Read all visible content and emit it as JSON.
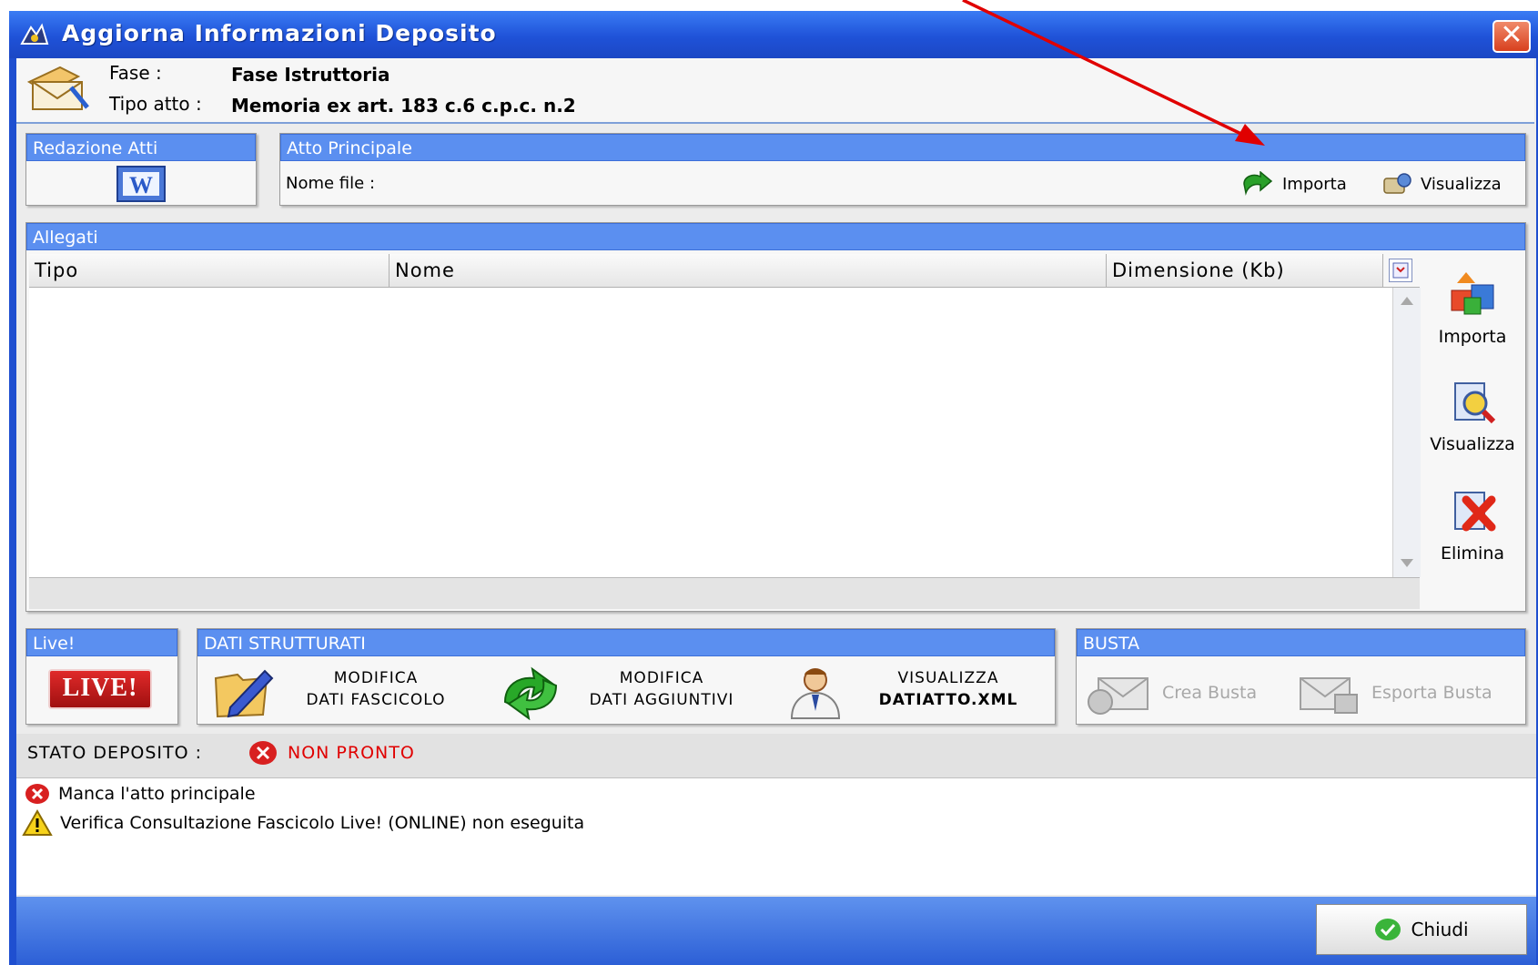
{
  "window": {
    "title": "Aggiorna Informazioni Deposito",
    "close_icon": "close-icon"
  },
  "header": {
    "fase_label": "Fase :",
    "fase_value": "Fase Istruttoria",
    "tipo_label": "Tipo atto :",
    "tipo_value": "Memoria ex art. 183 c.6 c.p.c. n.2"
  },
  "redazione": {
    "title": "Redazione Atti",
    "icon": "word-icon"
  },
  "atto_principale": {
    "title": "Atto Principale",
    "nome_file_label": "Nome file :",
    "importa_label": "Importa",
    "visualizza_label": "Visualizza"
  },
  "allegati": {
    "title": "Allegati",
    "columns": [
      "Tipo",
      "Nome",
      "Dimensione (Kb)"
    ],
    "rows": [],
    "actions": {
      "importa": "Importa",
      "visualizza": "Visualizza",
      "elimina": "Elimina"
    }
  },
  "live": {
    "title": "Live!",
    "logo_text": "LIVE!"
  },
  "dati_strutturati": {
    "title": "DATI STRUTTURATI",
    "modifica_fascicolo": {
      "line1": "MODIFICA",
      "line2": "DATI FASCICOLO"
    },
    "modifica_aggiuntivi": {
      "line1": "MODIFICA",
      "line2": "DATI AGGIUNTIVI"
    },
    "visualizza_xml": {
      "line1": "VISUALIZZA",
      "line2": "DATIATTO.XML"
    }
  },
  "busta": {
    "title": "BUSTA",
    "crea": "Crea Busta",
    "esporta": "Esporta Busta"
  },
  "stato": {
    "label": "STATO DEPOSITO :",
    "value": "NON PRONTO",
    "color": "#e00000",
    "messages": [
      {
        "icon": "error-icon",
        "text": "Manca l'atto principale"
      },
      {
        "icon": "warning-icon",
        "text": "Verifica Consultazione Fascicolo Live! (ONLINE) non eseguita"
      }
    ]
  },
  "footer": {
    "chiudi": "Chiudi"
  },
  "colors": {
    "titlebar": "#1f52d8",
    "panel_header": "#5b8ff0",
    "annotation_arrow": "#e00000"
  }
}
